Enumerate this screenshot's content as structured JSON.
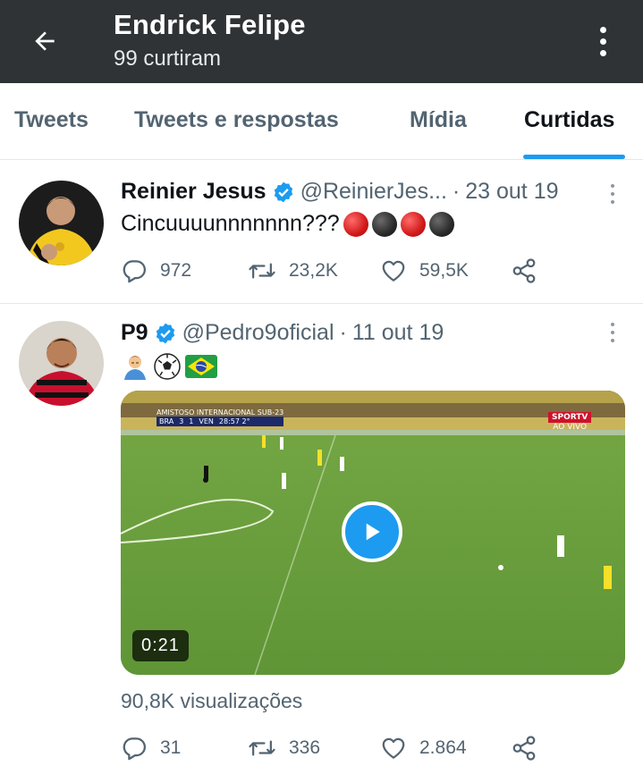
{
  "header": {
    "title": "Endrick Felipe",
    "subtitle": "99 curtiram",
    "back_icon": "arrow-left-icon",
    "more_icon": "more-vertical-icon"
  },
  "tabs": [
    {
      "label": "Tweets",
      "active": false
    },
    {
      "label": "Tweets e respostas",
      "active": false
    },
    {
      "label": "Mídia",
      "active": false
    },
    {
      "label": "Curtidas",
      "active": true
    }
  ],
  "colors": {
    "accent": "#1d9bf0",
    "header_bg": "#2f3336",
    "secondary_text": "#536471"
  },
  "tweets": [
    {
      "name": "Reinier Jesus",
      "handle": "@ReinierJes...",
      "separator": "·",
      "date": "23 out 19",
      "text": "Cincuuuunnnnnnn???",
      "emojis": [
        "red-circle",
        "black-circle",
        "red-circle",
        "black-circle"
      ],
      "replies": "972",
      "retweets": "23,2K",
      "likes": "59,5K"
    },
    {
      "name": "P9",
      "handle": "@Pedro9oficial",
      "separator": "·",
      "date": "11 out 19",
      "emojis": [
        "man-bowing",
        "soccer-ball",
        "brazil-flag"
      ],
      "media": {
        "type": "video",
        "duration": "0:21",
        "scoreboard": {
          "competition": "AMISTOSO INTERNACIONAL SUB-23",
          "home": "BRA",
          "home_score": "3",
          "away_score": "1",
          "away": "VEN",
          "clock": "28:57 2°"
        },
        "channel": "SPORTV",
        "channel_sub": "AO VIVO"
      },
      "views": "90,8K visualizações",
      "replies": "31",
      "retweets": "336",
      "likes": "2.864"
    }
  ]
}
